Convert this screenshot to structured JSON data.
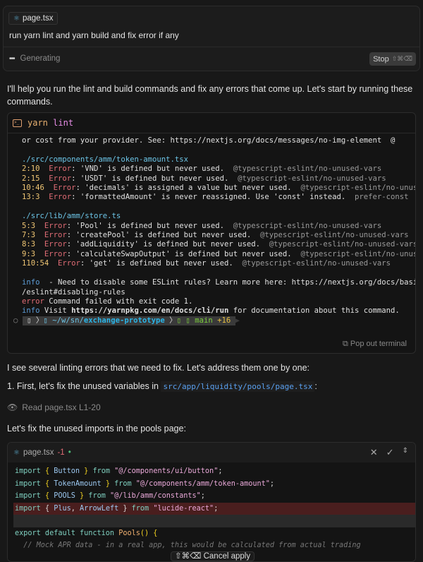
{
  "prompt": {
    "file_chip": "page.tsx",
    "text": "run yarn lint and yarn build and fix error if any",
    "status": "Generating",
    "stop_label": "Stop",
    "stop_shortcut": "⇧⌘⌫"
  },
  "messages": {
    "intro": "I'll help you run the lint and build commands and fix any errors that come up. Let's start by running these commands.",
    "see_errors": "I see several linting errors that we need to fix. Let's address them one by one:",
    "step1_prefix": "1. First, let's fix the unused variables in ",
    "step1_path": "src/app/liquidity/pools/page.tsx",
    "step1_suffix": ":",
    "read_action": "Read page.tsx L1-20",
    "fix_imports": "Let's fix the unused imports in the pools page:"
  },
  "terminal": {
    "cmd": "yarn",
    "arg": "lint",
    "lines": [
      [
        [
          "",
          "or cost from your provider. See: https://nextjs.org/docs/messages/no-img-element  @"
        ]
      ],
      [
        [
          "",
          ""
        ]
      ],
      [
        [
          "fn",
          "./src/components/amm/token-amount.tsx"
        ]
      ],
      [
        [
          "ln",
          "2:10  "
        ],
        [
          "er",
          "Error"
        ],
        [
          "",
          ": 'VND' is defined but never used.  "
        ],
        [
          "rule",
          "@typescript-eslint/no-unused-vars"
        ]
      ],
      [
        [
          "ln",
          "2:15  "
        ],
        [
          "er",
          "Error"
        ],
        [
          "",
          ": 'USDT' is defined but never used.  "
        ],
        [
          "rule",
          "@typescript-eslint/no-unused-vars"
        ]
      ],
      [
        [
          "ln",
          "10:46  "
        ],
        [
          "er",
          "Error"
        ],
        [
          "",
          ": 'decimals' is assigned a value but never used.  "
        ],
        [
          "rule",
          "@typescript-eslint/no-unused-vars"
        ]
      ],
      [
        [
          "ln",
          "13:3  "
        ],
        [
          "er",
          "Error"
        ],
        [
          "",
          ": 'formattedAmount' is never reassigned. Use 'const' instead.  "
        ],
        [
          "rule",
          "prefer-const"
        ]
      ],
      [
        [
          "",
          ""
        ]
      ],
      [
        [
          "fn",
          "./src/lib/amm/store.ts"
        ]
      ],
      [
        [
          "ln",
          "5:3  "
        ],
        [
          "er",
          "Error"
        ],
        [
          "",
          ": 'Pool' is defined but never used.  "
        ],
        [
          "rule",
          "@typescript-eslint/no-unused-vars"
        ]
      ],
      [
        [
          "ln",
          "7:3  "
        ],
        [
          "er",
          "Error"
        ],
        [
          "",
          ": 'createPool' is defined but never used.  "
        ],
        [
          "rule",
          "@typescript-eslint/no-unused-vars"
        ]
      ],
      [
        [
          "ln",
          "8:3  "
        ],
        [
          "er",
          "Error"
        ],
        [
          "",
          ": 'addLiquidity' is defined but never used.  "
        ],
        [
          "rule",
          "@typescript-eslint/no-unused-vars"
        ]
      ],
      [
        [
          "ln",
          "9:3  "
        ],
        [
          "er",
          "Error"
        ],
        [
          "",
          ": 'calculateSwapOutput' is defined but never used.  "
        ],
        [
          "rule",
          "@typescript-eslint/no-unused-vars"
        ]
      ],
      [
        [
          "ln",
          "110:54  "
        ],
        [
          "er",
          "Error"
        ],
        [
          "",
          ": 'get' is defined but never used.  "
        ],
        [
          "rule",
          "@typescript-eslint/no-unused-vars"
        ]
      ],
      [
        [
          "",
          ""
        ]
      ],
      [
        [
          "info",
          "info"
        ],
        [
          "",
          "  - Need to disable some ESLint rules? Learn more here: https://nextjs.org/docs/basic-features"
        ]
      ],
      [
        [
          "",
          "/eslint#disabling-rules"
        ]
      ],
      [
        [
          "er",
          "error"
        ],
        [
          "",
          " Command failed with exit code 1."
        ]
      ],
      [
        [
          "info",
          "info"
        ],
        [
          "",
          " Visit "
        ],
        [
          "b",
          "https://yarnpkg.com/en/docs/cli/run"
        ],
        [
          "",
          " for documentation about this command."
        ]
      ]
    ],
    "shell_prompt": {
      "path_prefix": "~/w/sn/",
      "path_dir": "exchange-prototype",
      "branch": "main",
      "changes": "+16"
    },
    "popout_label": "Pop out terminal"
  },
  "code_block": {
    "filename": "page.tsx",
    "diff_count": "-1",
    "lines": [
      [
        [
          "kw",
          "import "
        ],
        [
          "br",
          "{ "
        ],
        [
          "id",
          "Button"
        ],
        [
          "br",
          " }"
        ],
        [
          "kw",
          " from "
        ],
        [
          "st",
          "\"@/components/ui/button\""
        ],
        [
          "",
          "; "
        ]
      ],
      [
        [
          "kw",
          "import "
        ],
        [
          "br",
          "{ "
        ],
        [
          "id",
          "TokenAmount"
        ],
        [
          "br",
          " }"
        ],
        [
          "kw",
          " from "
        ],
        [
          "st",
          "\"@/components/amm/token-amount\""
        ],
        [
          "",
          ";"
        ]
      ],
      [
        [
          "kw",
          "import "
        ],
        [
          "br",
          "{ "
        ],
        [
          "id",
          "POOLS"
        ],
        [
          "br",
          " }"
        ],
        [
          "kw",
          " from "
        ],
        [
          "st",
          "\"@/lib/amm/constants\""
        ],
        [
          "",
          ";"
        ]
      ],
      [
        [
          "kw",
          "import "
        ],
        [
          "",
          "{ "
        ],
        [
          "id",
          "Plus"
        ],
        [
          "",
          ", "
        ],
        [
          "id",
          "ArrowLeft"
        ],
        [
          "",
          " } "
        ],
        [
          "kw",
          "from "
        ],
        [
          "st",
          "\"lucide-react\""
        ],
        [
          "",
          ";"
        ]
      ],
      [],
      [
        [
          "kw",
          "export default function "
        ],
        [
          "fnn",
          "Pools"
        ],
        [
          "br",
          "() {"
        ]
      ],
      [
        [
          "cm",
          "  // Mock APR data - in a real app, this would be calculated from actual trading"
        ]
      ]
    ]
  },
  "cancel_apply": {
    "shortcut": "⇧⌘⌫",
    "label": "Cancel apply"
  }
}
